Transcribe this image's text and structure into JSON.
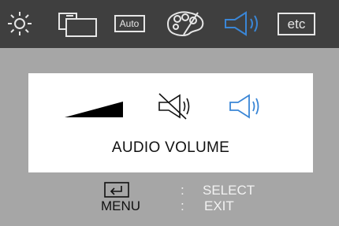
{
  "menu_tabs": [
    {
      "name": "brightness",
      "icon": "sun-icon"
    },
    {
      "name": "geometry",
      "icon": "screens-icon"
    },
    {
      "name": "auto",
      "icon": "auto-icon",
      "label": "Auto"
    },
    {
      "name": "color",
      "icon": "palette-icon"
    },
    {
      "name": "audio",
      "icon": "speaker-icon",
      "selected": true
    },
    {
      "name": "etc",
      "icon": "etc-icon",
      "label": "etc"
    }
  ],
  "panel": {
    "title": "AUDIO VOLUME",
    "options": [
      {
        "name": "volume-level",
        "icon": "volume-ramp-icon"
      },
      {
        "name": "mute",
        "icon": "mute-speaker-icon"
      },
      {
        "name": "sound-on",
        "icon": "speaker-icon",
        "selected": true
      }
    ]
  },
  "footer": {
    "enter_action": "SELECT",
    "menu_key": "MENU",
    "menu_action": "EXIT",
    "separator": ":"
  },
  "colors": {
    "topbar": "#3f3f3f",
    "background": "#a6a6a6",
    "panel": "#ffffff",
    "accent": "#3a86d6",
    "icon": "#e6e6e6"
  }
}
